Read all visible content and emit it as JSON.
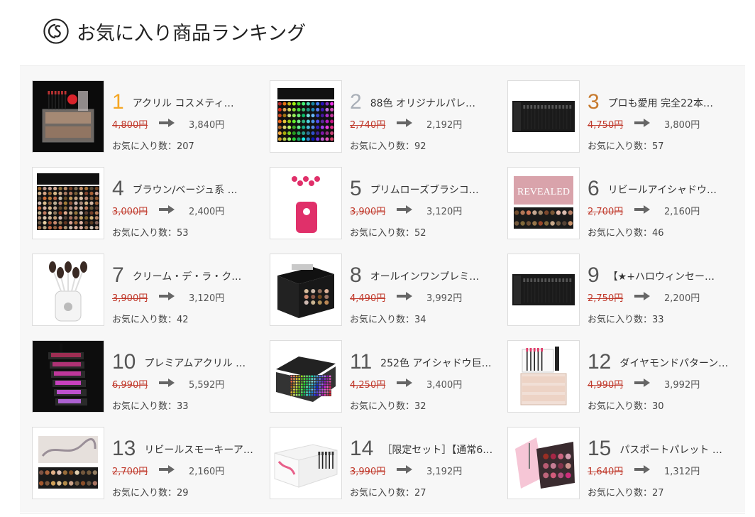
{
  "page": {
    "title": "お気に入り商品ランキング"
  },
  "labels": {
    "fav_prefix": "お気に入り数："
  },
  "colors": {
    "gold": "#f5a623",
    "silver": "#aab0b8",
    "bronze": "#c77a2e",
    "strike": "#c0392b"
  },
  "products": [
    {
      "rank": "1",
      "name": "アクリル コスメティ…",
      "old_price": "4,800円",
      "new_price": "3,840円",
      "favorites": "207",
      "image": "acrylic-cosmetic-case"
    },
    {
      "rank": "2",
      "name": "88色 オリジナルパレ…",
      "old_price": "2,740円",
      "new_price": "2,192円",
      "favorites": "92",
      "image": "eyeshadow-palette-88"
    },
    {
      "rank": "3",
      "name": "プロも愛用 完全22本…",
      "old_price": "4,750円",
      "new_price": "3,800円",
      "favorites": "57",
      "image": "brush-set-case"
    },
    {
      "rank": "4",
      "name": "ブラウン/ベージュ系 …",
      "old_price": "3,000円",
      "new_price": "2,400円",
      "favorites": "53",
      "image": "eyeshadow-palette-brown"
    },
    {
      "rank": "5",
      "name": "プリムローズブラシコ…",
      "old_price": "3,900円",
      "new_price": "3,120円",
      "favorites": "52",
      "image": "pink-brush-holder"
    },
    {
      "rank": "6",
      "name": "リビールアイシャドウ…",
      "old_price": "2,700円",
      "new_price": "2,160円",
      "favorites": "46",
      "image": "revealed-palette"
    },
    {
      "rank": "7",
      "name": "クリーム・デ・ラ・ク…",
      "old_price": "3,900円",
      "new_price": "3,120円",
      "favorites": "42",
      "image": "white-brush-holder"
    },
    {
      "rank": "8",
      "name": "オールインワンプレミ…",
      "old_price": "4,490円",
      "new_price": "3,992円",
      "favorites": "34",
      "image": "makeup-box"
    },
    {
      "rank": "9",
      "name": "【★+ハロウィンセー…",
      "old_price": "2,750円",
      "new_price": "2,200円",
      "favorites": "33",
      "image": "black-brush-case"
    },
    {
      "rank": "10",
      "name": "プレミアムアクリル …",
      "old_price": "6,990円",
      "new_price": "5,592円",
      "favorites": "33",
      "image": "rotating-lipstick-tower"
    },
    {
      "rank": "11",
      "name": "252色 アイシャドウ巨…",
      "old_price": "4,250円",
      "new_price": "3,400円",
      "favorites": "32",
      "image": "eyeshadow-palette-252"
    },
    {
      "rank": "12",
      "name": "ダイヤモンドパターン…",
      "old_price": "4,990円",
      "new_price": "3,992円",
      "favorites": "30",
      "image": "diamond-acrylic-organizer"
    },
    {
      "rank": "13",
      "name": "リビールスモーキーア…",
      "old_price": "2,700円",
      "new_price": "2,160円",
      "favorites": "29",
      "image": "smoky-palette"
    },
    {
      "rank": "14",
      "name": "［限定セット］【通常6…",
      "old_price": "3,990円",
      "new_price": "3,192円",
      "favorites": "27",
      "image": "limited-set-box"
    },
    {
      "rank": "15",
      "name": "パスポートパレット …",
      "old_price": "1,640円",
      "new_price": "1,312円",
      "favorites": "27",
      "image": "passport-palette"
    }
  ]
}
